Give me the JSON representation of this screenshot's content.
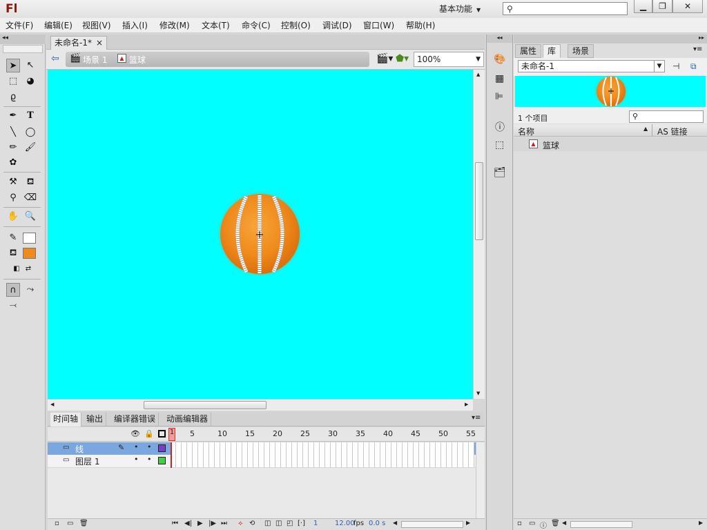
{
  "app": {
    "logo": "Fl",
    "workspace": "基本功能",
    "win_min": "▁",
    "win_restore": "❐",
    "win_close": "✕"
  },
  "menus": [
    "文件(F)",
    "编辑(E)",
    "视图(V)",
    "插入(I)",
    "修改(M)",
    "文本(T)",
    "命令(C)",
    "控制(O)",
    "调试(D)",
    "窗口(W)",
    "帮助(H)"
  ],
  "document": {
    "tab_title": "未命名-1*",
    "tab_close": "×",
    "scene": "场景 1",
    "symbol": "篮球",
    "zoom": "100%"
  },
  "stage": {
    "bg_color": "#00ffff"
  },
  "timeline": {
    "tabs": [
      "时间轴",
      "输出",
      "编译器错误",
      "动画编辑器"
    ],
    "ruler": [
      "1",
      "5",
      "10",
      "15",
      "20",
      "25",
      "30",
      "35",
      "40",
      "45",
      "50",
      "55"
    ],
    "layers": [
      {
        "name": "线",
        "selected": true,
        "color": "#7a3fc0"
      },
      {
        "name": "图层 1",
        "selected": false,
        "color": "#40d040"
      }
    ],
    "current_frame": "1",
    "fps": "12.00",
    "fps_unit": "fps",
    "time": "0.0 s"
  },
  "panel": {
    "tabs": [
      "属性",
      "库",
      "场景"
    ],
    "active_tab": "库",
    "library_doc": "未命名-1",
    "item_count": "1 个项目",
    "col_name": "名称",
    "col_linkage": "AS 链接",
    "items": [
      "篮球"
    ]
  }
}
